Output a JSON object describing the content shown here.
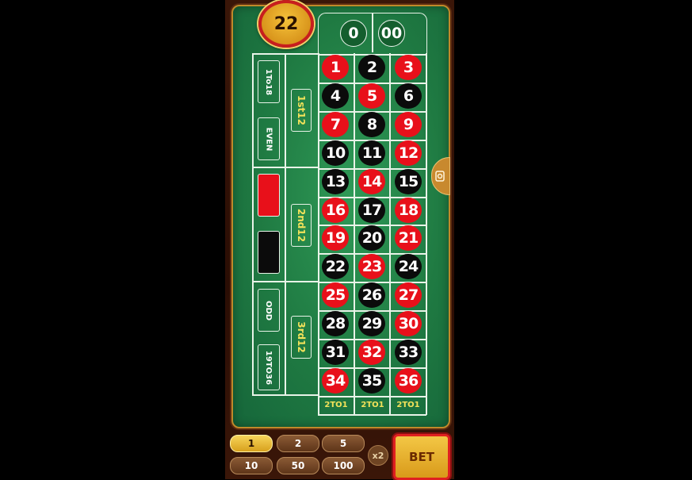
{
  "last_result": "22",
  "zeros": [
    "0",
    "00"
  ],
  "numbers": [
    {
      "n": "1",
      "c": "red"
    },
    {
      "n": "2",
      "c": "black"
    },
    {
      "n": "3",
      "c": "red"
    },
    {
      "n": "4",
      "c": "black"
    },
    {
      "n": "5",
      "c": "red"
    },
    {
      "n": "6",
      "c": "black"
    },
    {
      "n": "7",
      "c": "red"
    },
    {
      "n": "8",
      "c": "black"
    },
    {
      "n": "9",
      "c": "red"
    },
    {
      "n": "10",
      "c": "black"
    },
    {
      "n": "11",
      "c": "black"
    },
    {
      "n": "12",
      "c": "red"
    },
    {
      "n": "13",
      "c": "black"
    },
    {
      "n": "14",
      "c": "red"
    },
    {
      "n": "15",
      "c": "black"
    },
    {
      "n": "16",
      "c": "red"
    },
    {
      "n": "17",
      "c": "black"
    },
    {
      "n": "18",
      "c": "red"
    },
    {
      "n": "19",
      "c": "red"
    },
    {
      "n": "20",
      "c": "black"
    },
    {
      "n": "21",
      "c": "red"
    },
    {
      "n": "22",
      "c": "black"
    },
    {
      "n": "23",
      "c": "red"
    },
    {
      "n": "24",
      "c": "black"
    },
    {
      "n": "25",
      "c": "red"
    },
    {
      "n": "26",
      "c": "black"
    },
    {
      "n": "27",
      "c": "red"
    },
    {
      "n": "28",
      "c": "black"
    },
    {
      "n": "29",
      "c": "black"
    },
    {
      "n": "30",
      "c": "red"
    },
    {
      "n": "31",
      "c": "black"
    },
    {
      "n": "32",
      "c": "red"
    },
    {
      "n": "33",
      "c": "black"
    },
    {
      "n": "34",
      "c": "red"
    },
    {
      "n": "35",
      "c": "black"
    },
    {
      "n": "36",
      "c": "red"
    }
  ],
  "column_bets": [
    "2TO1",
    "2TO1",
    "2TO1"
  ],
  "dozens": [
    "1st12",
    "2nd12",
    "3rd12"
  ],
  "outside_bets": {
    "low": "1To18",
    "even": "EVEN",
    "odd": "ODD",
    "high": "19TO36"
  },
  "colors": {
    "red": "#e8101a",
    "black": "#0b0b0b",
    "felt": "#1f7a42"
  },
  "chips": {
    "values": [
      "1",
      "2",
      "5",
      "10",
      "50",
      "100"
    ],
    "selected": "1"
  },
  "multiplier_label": "x2",
  "bet_label": "BET"
}
